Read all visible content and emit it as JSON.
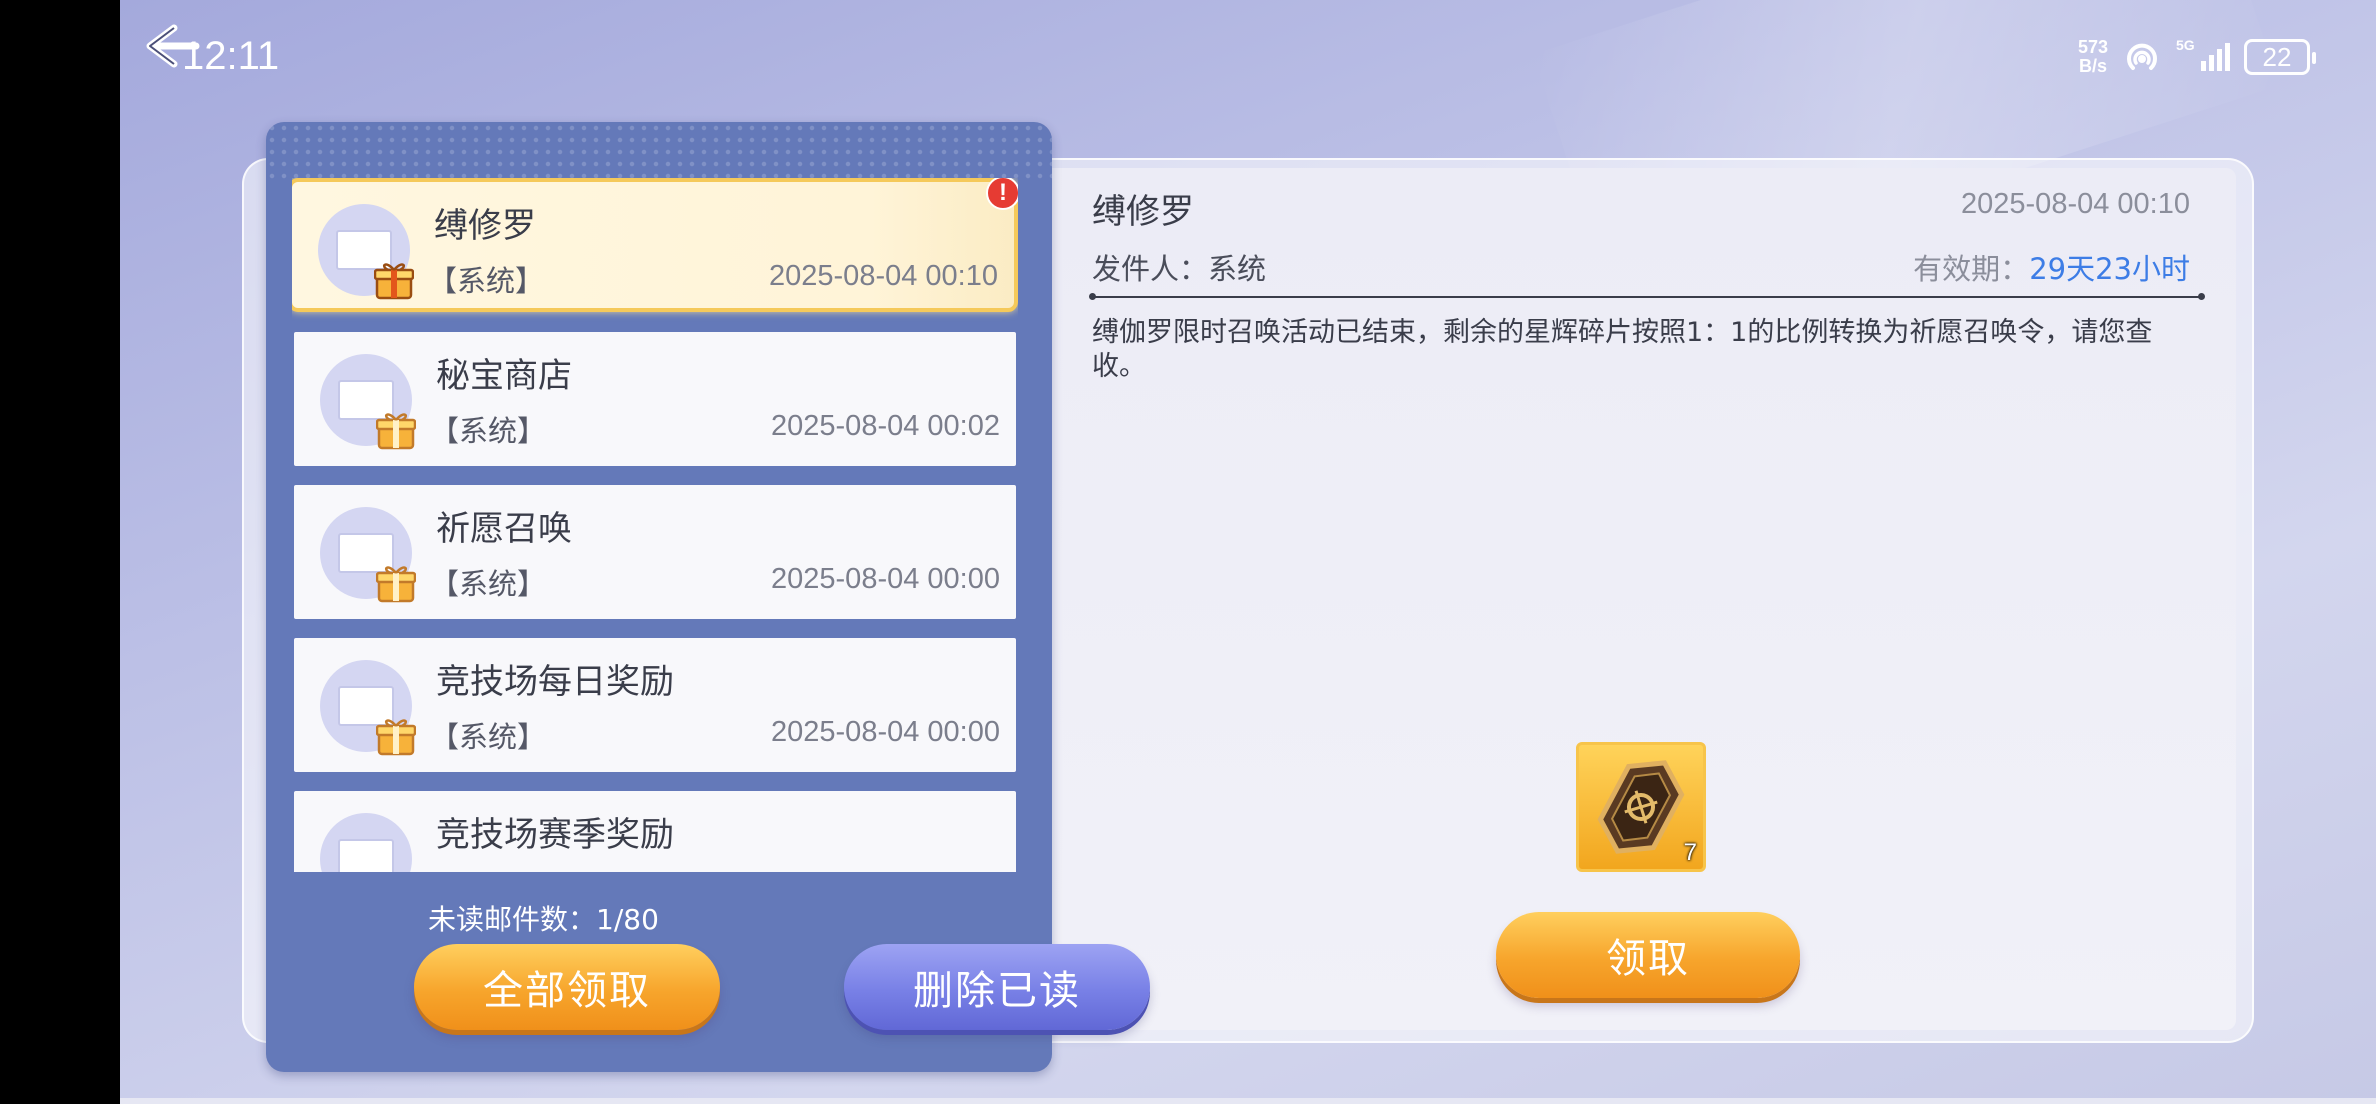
{
  "status_bar": {
    "time": "12:11",
    "net_speed_value": "573",
    "net_speed_unit": "B/s",
    "network": "5G",
    "battery": "22",
    "icons": [
      "back-arrow-icon",
      "hotspot-icon",
      "signal-icon",
      "battery-icon"
    ]
  },
  "mail_list": {
    "items": [
      {
        "title": "缚修罗",
        "sender": "【系统】",
        "date": "2025-08-04 00:10",
        "active": true,
        "alert": "!"
      },
      {
        "title": "秘宝商店",
        "sender": "【系统】",
        "date": "2025-08-04 00:02"
      },
      {
        "title": "祈愿召唤",
        "sender": "【系统】",
        "date": "2025-08-04 00:00"
      },
      {
        "title": "竞技场每日奖励",
        "sender": "【系统】",
        "date": "2025-08-04 00:00"
      },
      {
        "title": "竞技场赛季奖励",
        "sender": "",
        "date": ""
      }
    ],
    "unread_label": "未读邮件数：1/80",
    "claim_all_label": "全部领取",
    "delete_read_label": "删除已读"
  },
  "detail": {
    "title": "缚修罗",
    "date": "2025-08-04 00:10",
    "sender_label": "发件人：系统",
    "expiry_label": "有效期：",
    "expiry_value": "29天23小时",
    "body": "缚伽罗限时召唤活动已结束，剩余的星辉碎片按照1：1的比例转换为祈愿召唤令，请您查收。",
    "reward": {
      "icon": "summon-token-icon",
      "count": "7"
    },
    "claim_label": "领取"
  },
  "colors": {
    "accent_orange": "#f7a52c",
    "accent_blue": "#7880e6",
    "panel_blue": "#6479b9",
    "expiry_blue": "#3d7de6",
    "alert_red": "#e63b33"
  }
}
